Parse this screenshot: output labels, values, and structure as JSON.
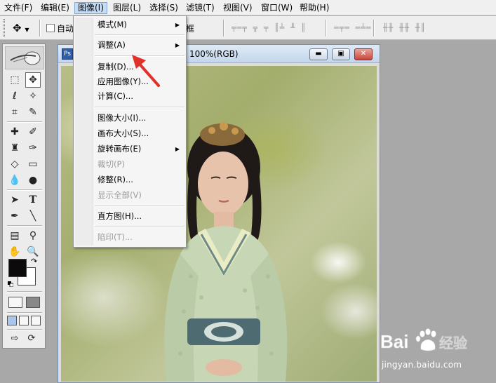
{
  "menubar": {
    "items": [
      "文件(F)",
      "编辑(E)",
      "图像(I)",
      "图层(L)",
      "选择(S)",
      "滤镜(T)",
      "视图(V)",
      "窗口(W)",
      "帮助(H)"
    ],
    "active_index": 2
  },
  "options_bar": {
    "auto_select_label": "自动",
    "trailing_label": "框"
  },
  "document": {
    "title": "100%(RGB)",
    "buttons": {
      "minimize": "▬",
      "restore": "▣",
      "close": "✕"
    }
  },
  "image_menu": {
    "items": [
      {
        "label": "模式(M)",
        "submenu": true,
        "enabled": true
      },
      {
        "label": "调整(A)",
        "submenu": true,
        "enabled": true
      },
      {
        "label": "复制(D)...",
        "submenu": false,
        "enabled": true
      },
      {
        "label": "应用图像(Y)...",
        "submenu": false,
        "enabled": true
      },
      {
        "label": "计算(C)...",
        "submenu": false,
        "enabled": true
      },
      {
        "label": "图像大小(I)...",
        "submenu": false,
        "enabled": true
      },
      {
        "label": "画布大小(S)...",
        "submenu": false,
        "enabled": true
      },
      {
        "label": "旋转画布(E)",
        "submenu": true,
        "enabled": true
      },
      {
        "label": "裁切(P)",
        "submenu": false,
        "enabled": false
      },
      {
        "label": "修整(R)...",
        "submenu": false,
        "enabled": true
      },
      {
        "label": "显示全部(V)",
        "submenu": false,
        "enabled": false
      },
      {
        "label": "直方图(H)...",
        "submenu": false,
        "enabled": true
      },
      {
        "label": "陷印(T)...",
        "submenu": false,
        "enabled": false
      }
    ],
    "submenu_arrow": "▶"
  },
  "toolbox": {
    "tool_icons": [
      "marquee-icon",
      "move-icon",
      "lasso-icon",
      "magic-wand-icon",
      "crop-icon",
      "slice-icon",
      "healing-brush-icon",
      "brush-icon",
      "clone-stamp-icon",
      "history-brush-icon",
      "eraser-icon",
      "gradient-icon",
      "blur-icon",
      "dodge-icon",
      "path-select-icon",
      "type-icon",
      "pen-icon",
      "line-icon",
      "notes-icon",
      "eyedropper-icon",
      "hand-icon",
      "zoom-icon"
    ],
    "foreground_color": "#0d0a0c",
    "background_color": "#ffffff"
  },
  "watermark": {
    "brand": "Bai",
    "brand_suffix": "经验",
    "url": "jingyan.baidu.com"
  },
  "colors": {
    "annotation_arrow": "#e0322b",
    "menu_active_bg": "#c6dcf4"
  }
}
